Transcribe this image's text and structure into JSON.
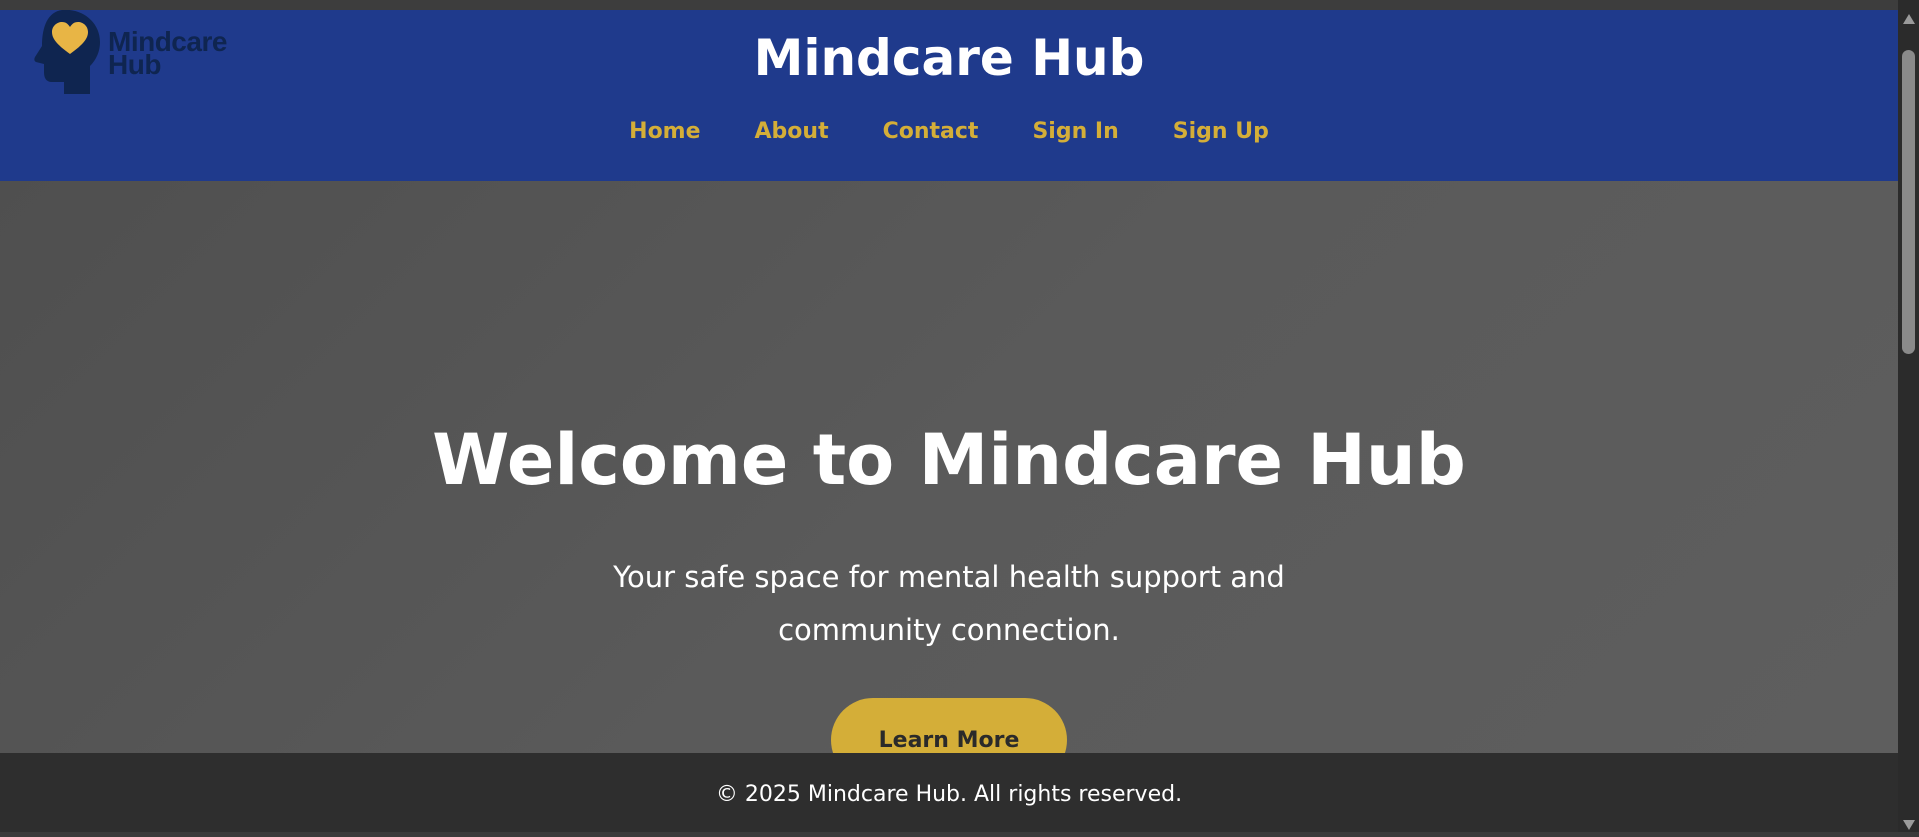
{
  "header": {
    "logo": {
      "icon": "head-heart-icon",
      "line1": "Mindcare",
      "line2": "Hub",
      "head_color": "#0f2550",
      "heart_color": "#e8b545"
    },
    "title": "Mindcare Hub",
    "background_color": "#1f3a8c",
    "nav": [
      {
        "label": "Home"
      },
      {
        "label": "About"
      },
      {
        "label": "Contact"
      },
      {
        "label": "Sign In"
      },
      {
        "label": "Sign Up"
      }
    ],
    "nav_color": "#d4ae38"
  },
  "hero": {
    "title": "Welcome to Mindcare Hub",
    "subtitle": "Your safe space for mental health support and community connection.",
    "cta_label": "Learn More",
    "cta_color": "#d4ae38"
  },
  "footer": {
    "text": "© 2025 Mindcare Hub. All rights reserved."
  }
}
